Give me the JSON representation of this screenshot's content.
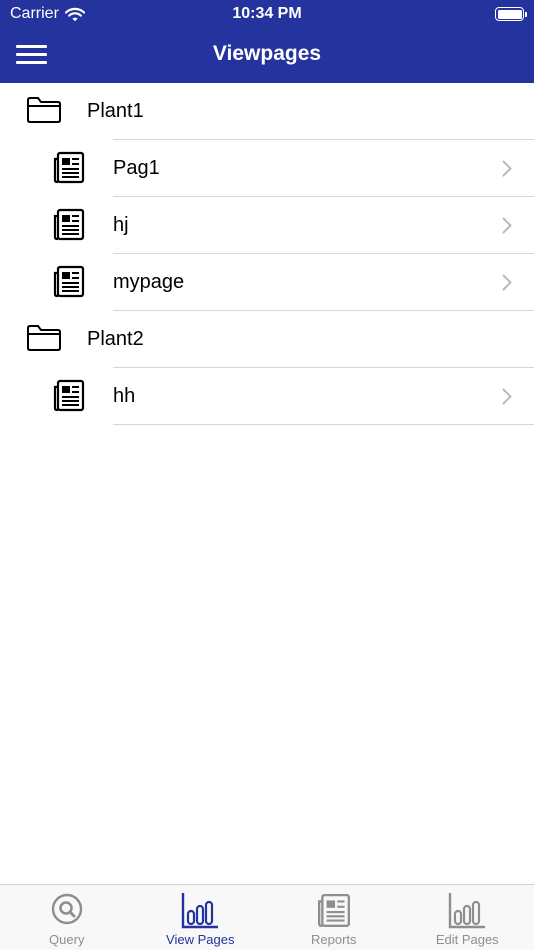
{
  "status_bar": {
    "carrier": "Carrier",
    "time": "10:34 PM"
  },
  "header": {
    "title": "Viewpages"
  },
  "groups": [
    {
      "name": "Plant1",
      "pages": [
        "Pag1",
        "hj",
        "mypage"
      ]
    },
    {
      "name": "Plant2",
      "pages": [
        "hh"
      ]
    }
  ],
  "tabs": [
    {
      "label": "Query",
      "icon": "search-circle-icon",
      "active": false
    },
    {
      "label": "View Pages",
      "icon": "bar-chart-icon",
      "active": true
    },
    {
      "label": "Reports",
      "icon": "report-document-icon",
      "active": false
    },
    {
      "label": "Edit Pages",
      "icon": "bar-chart-icon",
      "active": false
    }
  ],
  "colors": {
    "accent": "#24339e",
    "inactive_tab": "#8e8e8e",
    "divider": "#d6d6d6"
  }
}
